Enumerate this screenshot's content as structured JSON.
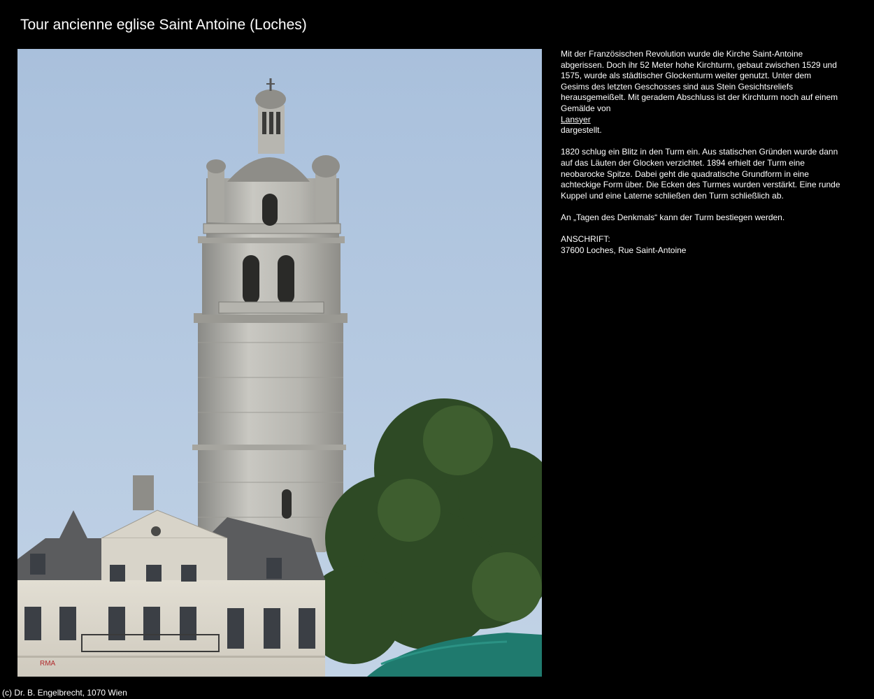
{
  "page": {
    "title": "Tour ancienne eglise Saint Antoine (Loches)"
  },
  "photo": {
    "sign_text": "RMA"
  },
  "description": {
    "p1_before": "Mit der Französischen Revolution wurde die Kirche Saint-Antoine abgerissen. Doch ihr 52 Meter hohe Kirchturm, gebaut zwischen 1529 und 1575, wurde als städtischer Glockenturm weiter genutzt. Unter dem Gesims des letzten Geschosses sind aus Stein Gesichtsreliefs herausgemeißelt. Mit geradem Abschluss ist der Kirchturm noch auf einem Gemälde von",
    "p1_link": "Lansyer",
    "p1_after": "dargestellt.",
    "p2": "1820 schlug ein Blitz in den Turm ein. Aus statischen Gründen wurde dann auf das Läuten der Glocken verzichtet. 1894 erhielt der Turm eine neobarocke Spitze. Dabei geht die quadratische Grundform in eine achteckige Form über. Die Ecken des Turmes wurden verstärkt. Eine runde Kuppel und eine Laterne schließen den Turm schließlich ab.",
    "p3": "An „Tagen des Denkmals“ kann der Turm bestiegen werden.",
    "address_label": "ANSCHRIFT:",
    "address_value": "37600 Loches, Rue Saint-Antoine"
  },
  "footer": {
    "copyright": "(c) Dr. B. Engelbrecht, 1070 Wien"
  }
}
